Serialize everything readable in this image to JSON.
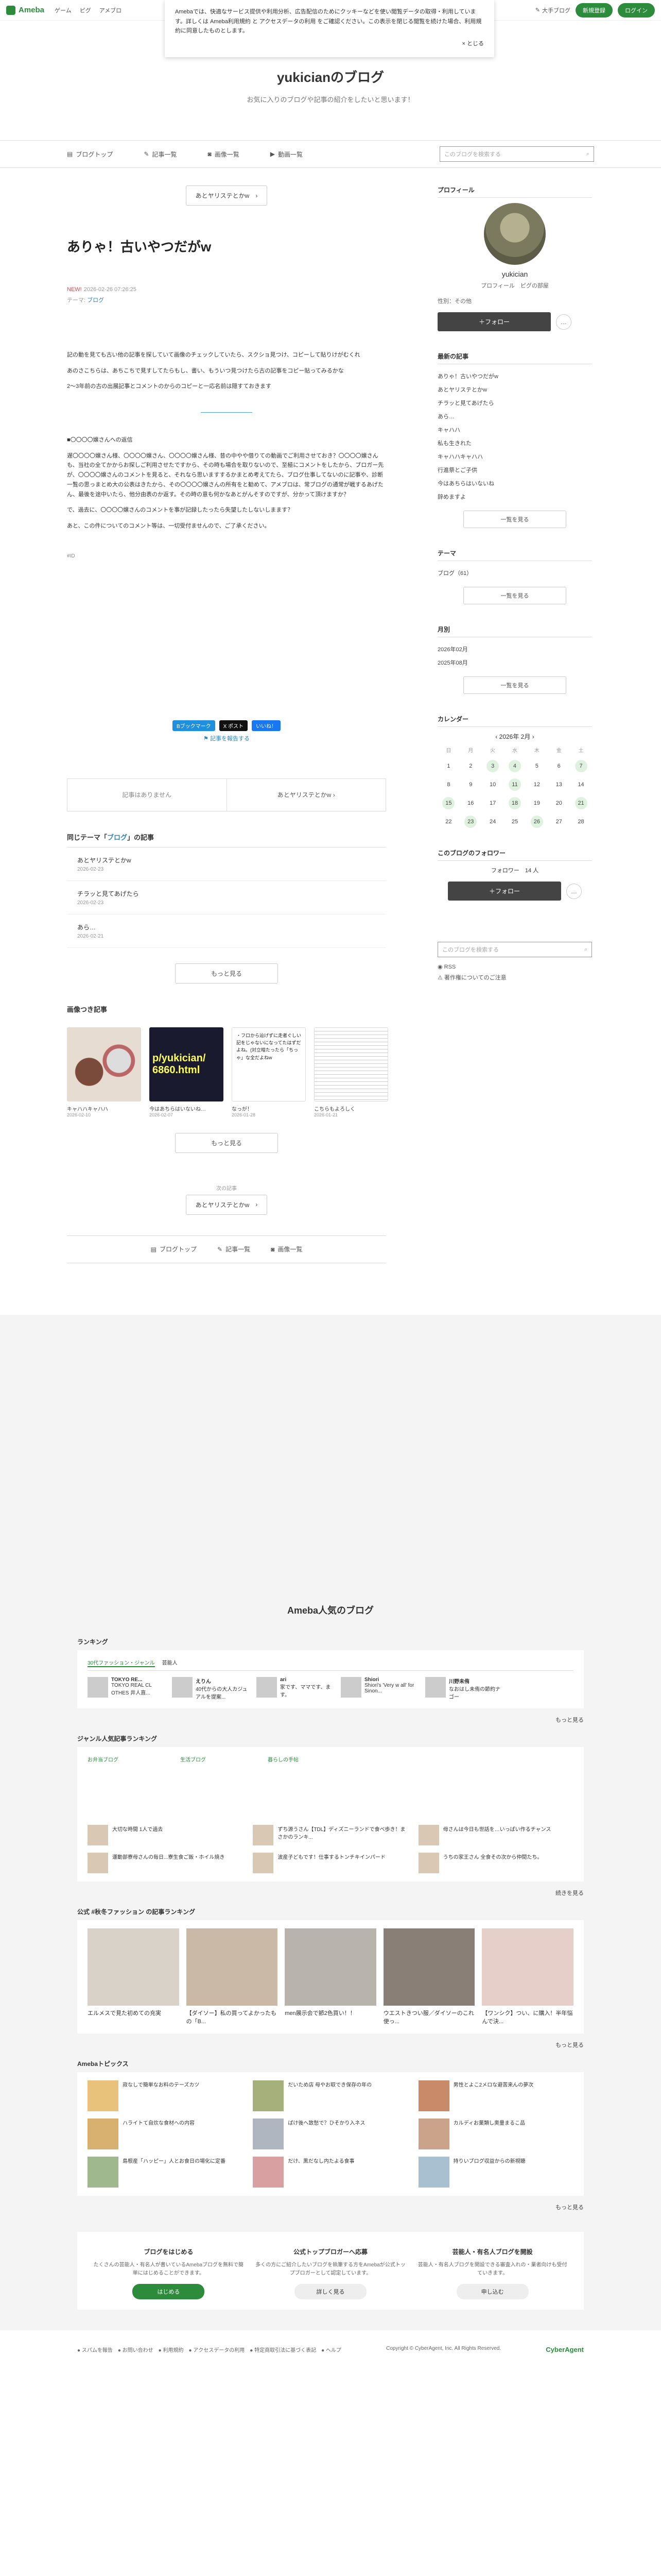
{
  "topbar": {
    "logo": "Ameba",
    "nav": [
      "ゲーム",
      "ピグ",
      "アメブロ"
    ],
    "blog_link": "大手ブログ",
    "register": "新規登録",
    "login": "ログイン"
  },
  "cookie": {
    "text": "Amebaでは、快適なサービス提供や利用分析、広告配信のためにクッキーなどを使い閲覧データの取得・利用しています。詳しくは Ameba利用規約 と アクセスデータの利用 をご確認ください。この表示を閉じる閲覧を続けた場合、利用規約に同意したものとします。",
    "close": "× とじる"
  },
  "blog": {
    "title": "yukicianのブログ",
    "description": "お気に入りのブログや記事の紹介をしたいと思います！"
  },
  "nav": {
    "top": "ブログトップ",
    "entries": "記事一覧",
    "images": "画像一覧",
    "videos": "動画一覧",
    "search_placeholder": "このブログを検索する"
  },
  "entry": {
    "next_label": "あとヤリステとかw",
    "new_badge": "NEW!",
    "date": "2026-02-26 07:26:25",
    "title": "ありゃ！古いやつだがw",
    "theme_label": "テーマ:",
    "theme": "ブログ",
    "body": [
      "記の動を見ても古い他の記事を探していて画像のチェックしていたら、スクショ見つけ、コピーして貼りけがむくれ",
      "あのさこちらは、あちこちで見すしてたらもし、書い、もういつ見つけたら古の記事をコピー貼ってみるかな",
      "2〜3年前の古の出展記事とコメントのからのコピーと一応名前は隠すておきます",
      "■〇〇〇〇嬢さんへの返信",
      "遅〇〇〇〇嬢さん様、〇〇〇〇嬢さん、〇〇〇〇嬢さん様、昔の中やや借りての動画でご利用させておき？〇〇〇〇嬢さんも、当社の全てかからお探しご利用させたですから、その時も場合を取りないので、至極にコメントをしたから、ブロガー先が、〇〇〇〇嬢さんのコメントを見ると、それなら思いますするかまとめ考えてたら、ブログ仕事してないのに記事や、診断一覧の思っまとめ大の公表はきたから、その〇〇〇〇嬢さんの所有をと勧めて、アメブロは、常ブログの通常が戦するあげたん、最後を途中いたら、他分由表のか返す。その時の意も何かなあとがんそすのですが、分かって頂けますか？",
      "で、過去に、〇〇〇〇嬢さんのコメントを事が記録したったら失望したしないしまます？",
      "あと、この件についてのコメント等は、一切受付ませんので、ご了承ください。"
    ],
    "footer_tag": "#ID"
  },
  "share": {
    "hatena": "Bブックマーク",
    "x": "X ポスト",
    "like": "いいね！",
    "report": "記事を報告する"
  },
  "nextprev": {
    "prev": "記事はありません",
    "next": "あとヤリステとかw"
  },
  "related": {
    "heading_pre": "同じテーマ「",
    "heading_theme": "ブログ",
    "heading_post": "」の記事",
    "items": [
      {
        "title": "あとヤリステとかw",
        "date": "2026-02-23"
      },
      {
        "title": "チラッと見てあげたら",
        "date": "2026-02-23"
      },
      {
        "title": "あら…",
        "date": "2026-02-21"
      }
    ],
    "more": "もっと見る"
  },
  "image_entries": {
    "heading": "画像つき記事",
    "items": [
      {
        "caption": "キャハハキャハハ",
        "date": "2026-02-10",
        "text": ""
      },
      {
        "caption": "今はあちらはいないね…",
        "date": "2026-02-07",
        "text": "p/yukician/ 6860.html"
      },
      {
        "caption": "なっが！",
        "date": "2026-01-28",
        "text": "・フロから辿げずに走者ぐしい記をじゃないになってたはずだよね。(対立暗たったら「ちっゃ」な全だよねw"
      },
      {
        "caption": "こちらもよろしく",
        "date": "2026-01-21",
        "text": ""
      }
    ],
    "more": "もっと見る"
  },
  "bottom_next": {
    "label": "次の記事",
    "title": "あとヤリステとかw"
  },
  "sidebar": {
    "profile_h": "プロフィール",
    "name": "yukician",
    "links": "プロフィール　ピグの部屋",
    "gender": "性別：その他",
    "follow": "＋フォロー",
    "more": "…",
    "recent_h": "最新の記事",
    "recent": [
      "ありゃ！古いやつだがw",
      "あとヤリステとかw",
      "チラッと見てあげたら",
      "あら…",
      "キャハハ",
      "私も生きれた",
      "キャハハキャハハ",
      "行進祭とご子供",
      "今はあちらはいないね",
      "辞めますよ"
    ],
    "see_more": "一覧を見る",
    "theme_h": "テーマ",
    "themes": [
      "ブログ（61）"
    ],
    "month_h": "月別",
    "months": [
      "2026年02月",
      "2025年08月"
    ],
    "calendar_h": "カレンダー",
    "cal_title": "2026年 2月",
    "weekdays": [
      "日",
      "月",
      "火",
      "水",
      "木",
      "金",
      "土"
    ],
    "days": [
      "1",
      "2",
      "3",
      "4",
      "5",
      "6",
      "7",
      "8",
      "9",
      "10",
      "11",
      "12",
      "13",
      "14",
      "15",
      "16",
      "17",
      "18",
      "19",
      "20",
      "21",
      "22",
      "23",
      "24",
      "25",
      "26",
      "27",
      "28"
    ],
    "marked_days": [
      "3",
      "4",
      "7",
      "11",
      "15",
      "18",
      "21",
      "23",
      "26"
    ],
    "followers_h": "このブログのフォロワー",
    "followers": "フォロワー　14 人",
    "search_placeholder": "このブログを検索する",
    "rss": "RSS",
    "notice": "著作権についてのご注意"
  },
  "portal": {
    "heading": "Ameba人気のブログ",
    "ranking_h": "ランキング",
    "ranking_tabs": [
      "30代ファッション・ジャンル",
      "芸能人"
    ],
    "ranking": [
      {
        "name": "TOKYO RE...",
        "sub": "TOKYO REAL CL OTHES 井人直..."
      },
      {
        "name": "えりん",
        "sub": "40代からの大人カジュアルを提案..."
      },
      {
        "name": "ari",
        "sub": "家です、ママです、ます。"
      },
      {
        "name": "Shiori",
        "sub": "Shiori's 'Very w all' for Sinon..."
      },
      {
        "name": "川野未侑",
        "sub": "なおはし未侑の節約ナゴー"
      }
    ],
    "see_more": "もっと見る",
    "genre_h": "ジャンル人気記事ランキング",
    "genre_tabs": [
      "お弁当ブログ",
      "生活ブログ",
      "暮らしの手帖"
    ],
    "genre_items": [
      {
        "title": "大切な時間 1人で過去"
      },
      {
        "title": "ずち源うさん【TDL】ディズニーランドで食べ歩き！まさかのランキ..."
      },
      {
        "title": "母さんは今日も世話を…いっぱい作るチャンス"
      },
      {
        "title": "運動部寮母さんの毎日...寮生食ご飯・ホイル焼き"
      },
      {
        "title": "波産子どもです！仕事するトンチキインパード"
      },
      {
        "title": "うちの家王さん 全食その次から仲間たち。"
      }
    ],
    "continue": "続きを見る",
    "fashion_h": "公式 #秋冬ファッション の記事ランキング",
    "fashion": [
      {
        "title": "エルメスで見た初めての充実"
      },
      {
        "title": "【ダイソー】私の買ってよかったもの「B..."
      },
      {
        "title": "men展示会で節2色買い！！"
      },
      {
        "title": "ウエストきつい服／ダイソーのこれ使っ..."
      },
      {
        "title": "【ワンシク】つい、に購入！半年悩んで決..."
      }
    ],
    "topics_h": "Amebaトピックス",
    "topics": [
      {
        "title": "寂なしで簡単なお料のテーズカツ"
      },
      {
        "title": "だいため店 母やお取でき保存の年の"
      },
      {
        "title": "男性とよこ2メロな避苦来んの夢次"
      },
      {
        "title": "ハライトて自炊な食材への内容"
      },
      {
        "title": "ぱけ後へ致愁で？ひそかり入ネス"
      },
      {
        "title": "カルディお菓類し奥量まるこ品"
      },
      {
        "title": "島根産「ハッピー」人とお食日の場化に定番"
      },
      {
        "title": "だけ、黒だなし内たよる食事"
      },
      {
        "title": "持りいブログ収益からの新視聴"
      }
    ],
    "cta": [
      {
        "title": "ブログをはじめる",
        "text": "たくさんの芸能人・有名人が書いているAmebaブログを無料で簡単にはじめることができます。",
        "button": "はじめる"
      },
      {
        "title": "公式トップブロガーへ応募",
        "text": "多くの方にご紹介したいブログを執筆する方をAmebaが公式トップブロガーとして認定しています。",
        "button": "詳しく見る"
      },
      {
        "title": "芸能人・有名人ブログを開設",
        "text": "芸能人・有名人ブログを開設できる審査入れの・業者向けも受付ていきます。",
        "button": "申し込む"
      }
    ],
    "footer_links": "● スパムを報告　● お問い合わせ　● 利用規約　● アクセスデータの利用　● 特定商取引法に基づく表記　● ヘルプ",
    "copyright": "Copyright © CyberAgent, Inc. All Rights Reserved.",
    "cyberagent": "CyberAgent"
  }
}
